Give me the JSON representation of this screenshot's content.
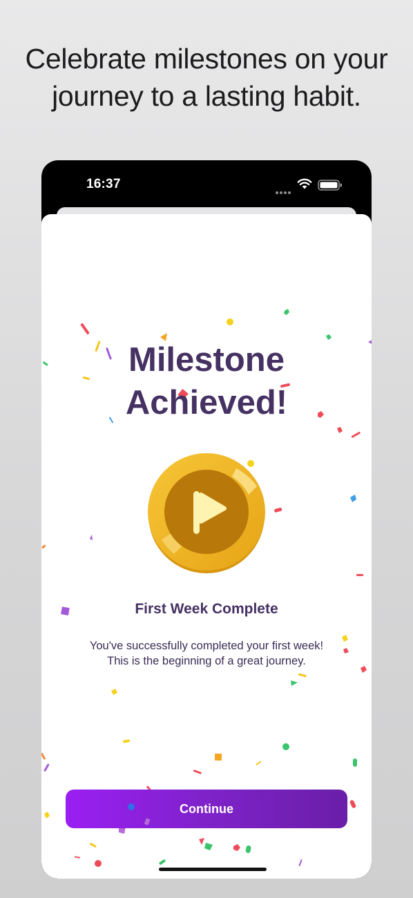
{
  "headline": "Celebrate milestones on your journey to a lasting habit.",
  "status_bar": {
    "time": "16:37",
    "icons": [
      "signal-dots-icon",
      "wifi-icon",
      "battery-icon"
    ]
  },
  "milestone": {
    "title_line1": "Milestone",
    "title_line2": "Achieved!",
    "badge_icon": "flag-icon",
    "name": "First Week Complete",
    "description_line1": "You've successfully completed your first week!",
    "description_line2": "This is the beginning of a great journey."
  },
  "actions": {
    "continue_label": "Continue"
  },
  "colors": {
    "title": "#463163",
    "button_start": "#9a1ff2",
    "button_end": "#6a1ea8",
    "medal_outer": "#f0b92a",
    "medal_inner": "#b8790a",
    "flag": "#fff3b0"
  }
}
